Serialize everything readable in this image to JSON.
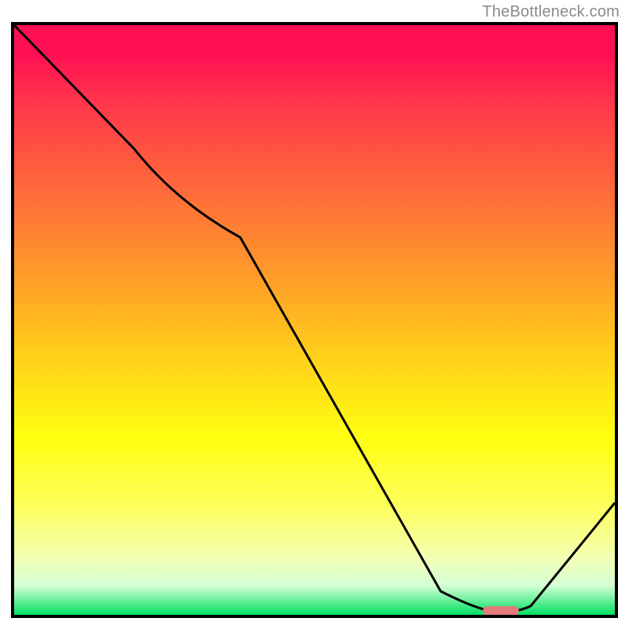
{
  "watermark": "TheBottleneck.com",
  "chart_data": {
    "type": "line",
    "title": "",
    "xlabel": "",
    "ylabel": "",
    "xlim": [
      0,
      1
    ],
    "ylim": [
      0,
      1
    ],
    "series": [
      {
        "name": "curve",
        "points": [
          {
            "x": 0.0,
            "y": 1.0
          },
          {
            "x": 0.2,
            "y": 0.79
          },
          {
            "x": 0.27,
            "y": 0.7
          },
          {
            "x": 0.71,
            "y": 0.04
          },
          {
            "x": 0.78,
            "y": 0.004
          },
          {
            "x": 0.84,
            "y": 0.005
          },
          {
            "x": 1.0,
            "y": 0.19
          }
        ]
      }
    ],
    "marker": {
      "x_start": 0.78,
      "x_end": 0.84,
      "y": 0.007,
      "color": "#e47a7a"
    },
    "gradient_stops": [
      {
        "pos": 0.0,
        "color": "#ff1053"
      },
      {
        "pos": 0.7,
        "color": "#ffff10"
      },
      {
        "pos": 1.0,
        "color": "#00e060"
      }
    ]
  }
}
